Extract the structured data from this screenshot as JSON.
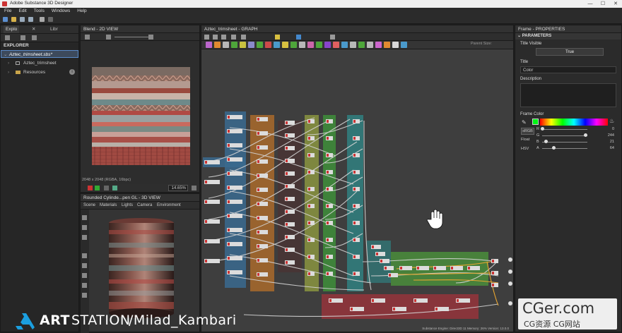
{
  "window": {
    "title": "Adobe Substance 3D Designer",
    "minimize": "—",
    "maximize": "☐",
    "close": "✕"
  },
  "menu": [
    "File",
    "Edit",
    "Tools",
    "Windows",
    "Help"
  ],
  "explorer": {
    "tabs": [
      "Explo",
      "Libr"
    ],
    "header": "EXPLORER",
    "package": "Aztec_trimsheet.sbs*",
    "graph": "Aztec_trimsheet",
    "resources": "Resources"
  },
  "view2d": {
    "title": "Blend - 2D VIEW",
    "status": "2048 x 2048 (RGBA, 16bpc)",
    "zoom": "14.65%"
  },
  "view3d": {
    "title": "Rounded Cylinde...pen GL - 3D VIEW",
    "menus": [
      "Scene",
      "Materials",
      "Lights",
      "Camera",
      "Environment"
    ]
  },
  "graph": {
    "title": "Aztec_trimsheet - GRAPH",
    "parent_size": "Parent Size:",
    "status": "Substance Engine: Direct3D 11  Memory: 26%",
    "version": "Version: 13.0.0"
  },
  "properties": {
    "title": "Frame - PROPERTIES",
    "section": "PARAMETERS",
    "title_visible_label": "Title Visible",
    "title_visible_value": "True",
    "title_label": "Title",
    "title_value": "Color",
    "description_label": "Description",
    "frame_color_label": "Frame Color",
    "mode_buttons": [
      "sRGB",
      "Float",
      "HSV"
    ],
    "channels": [
      {
        "label": "R",
        "value": "0",
        "level": 0.0
      },
      {
        "label": "G",
        "value": "244",
        "level": 0.957
      },
      {
        "label": "B",
        "value": "21",
        "level": 0.082
      },
      {
        "label": "A",
        "value": "64",
        "level": 0.251
      }
    ],
    "color_hex": "#00f415"
  },
  "watermark": {
    "brand_bold": "ART",
    "brand_light": "STATION",
    "author": "/Milad_Kambari",
    "site": "CGer.com",
    "site_sub": "CG资源 CG网站"
  },
  "colors": {
    "frame_blue": "#3a6a8f",
    "frame_orange": "#b8702a",
    "frame_olive": "#9aa640",
    "frame_green": "#3f9a3a",
    "frame_teal": "#2f8a8a",
    "frame_red": "#a8323a",
    "frame_lime": "#4ea63a"
  }
}
